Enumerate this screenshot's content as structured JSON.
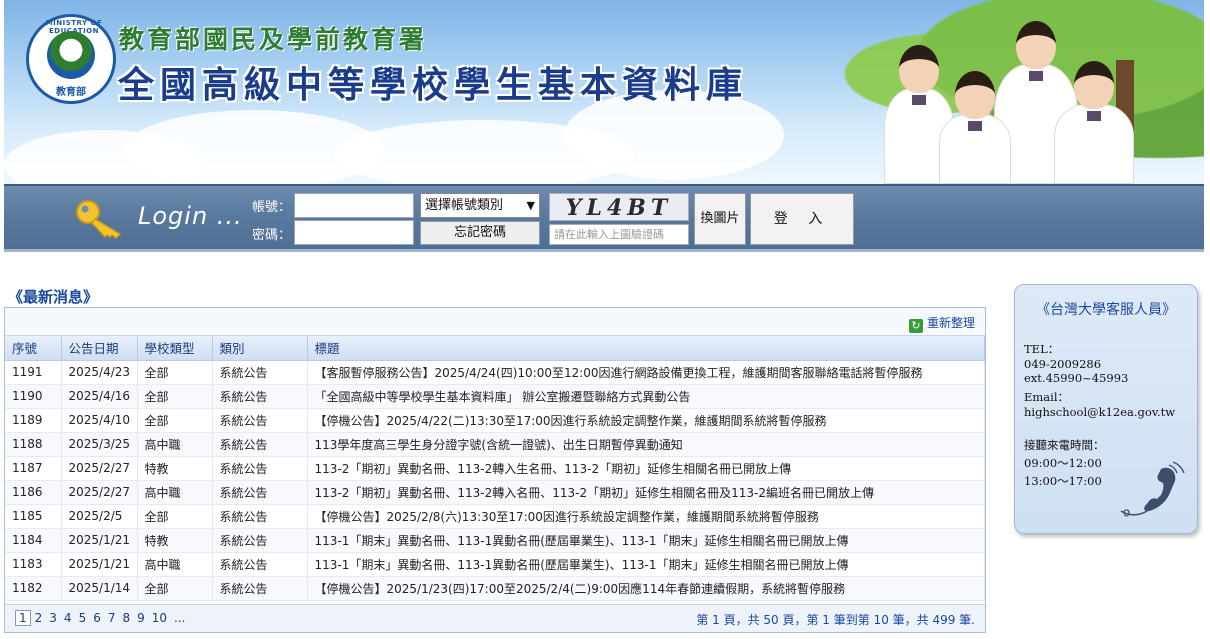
{
  "banner": {
    "logo_ring_text": "MINISTRY OF EDUCATION",
    "logo_bottom_text": "教育部",
    "sub_title": "教育部國民及學前教育署",
    "main_title": "全國高級中等學校學生基本資料庫"
  },
  "login": {
    "heading": "Login ...",
    "account_label": "帳號：",
    "password_label": "密碼：",
    "account_value": "",
    "password_value": "",
    "account_type_selected": "選擇帳號類別",
    "forgot_label": "忘記密碼",
    "captcha_text": "YL4BT",
    "captcha_placeholder": "請在此輸入上圖驗證碼",
    "swap_label": "換圖片",
    "login_label": "登 入"
  },
  "news": {
    "heading": "《最新消息》",
    "refresh_label": "重新整理",
    "columns": [
      "序號",
      "公告日期",
      "學校類型",
      "類別",
      "標題"
    ],
    "rows": [
      [
        "1191",
        "2025/4/23",
        "全部",
        "系統公告",
        "【客服暫停服務公告】2025/4/24(四)10:00至12:00因進行網路設備更換工程，維護期間客服聯絡電話將暫停服務"
      ],
      [
        "1190",
        "2025/4/16",
        "全部",
        "系統公告",
        "「全國高級中等學校學生基本資料庫」 辦公室搬遷暨聯絡方式異動公告"
      ],
      [
        "1189",
        "2025/4/10",
        "全部",
        "系統公告",
        "【停機公告】2025/4/22(二)13:30至17:00因進行系統設定調整作業，維護期間系統將暫停服務"
      ],
      [
        "1188",
        "2025/3/25",
        "高中職",
        "系統公告",
        "113學年度高三學生身分證字號(含統一證號)、出生日期暫停異動通知"
      ],
      [
        "1187",
        "2025/2/27",
        "特教",
        "系統公告",
        "113-2「期初」異動名冊、113-2轉入生名冊、113-2「期初」延修生相關名冊已開放上傳"
      ],
      [
        "1186",
        "2025/2/27",
        "高中職",
        "系統公告",
        "113-2「期初」異動名冊、113-2轉入名冊、113-2「期初」延修生相關名冊及113-2編班名冊已開放上傳"
      ],
      [
        "1185",
        "2025/2/5",
        "全部",
        "系統公告",
        "【停機公告】2025/2/8(六)13:30至17:00因進行系統設定調整作業，維護期間系統將暫停服務"
      ],
      [
        "1184",
        "2025/1/21",
        "特教",
        "系統公告",
        "113-1「期末」異動名冊、113-1異動名冊(歷屆畢業生)、113-1「期末」延修生相關名冊已開放上傳"
      ],
      [
        "1183",
        "2025/1/21",
        "高中職",
        "系統公告",
        "113-1「期末」異動名冊、113-1異動名冊(歷屆畢業生)、113-1「期末」延修生相關名冊已開放上傳"
      ],
      [
        "1182",
        "2025/1/14",
        "全部",
        "系統公告",
        "【停機公告】2025/1/23(四)17:00至2025/2/4(二)9:00因應114年春節連續假期，系統將暫停服務"
      ]
    ],
    "pages": [
      "1",
      "2",
      "3",
      "4",
      "5",
      "6",
      "7",
      "8",
      "9",
      "10",
      "..."
    ],
    "page_info": "第 1 頁，共 50 頁，第 1 筆到第 10 筆，共 499 筆."
  },
  "support": {
    "title": "《台灣大學客服人員》",
    "tel_label": "TEL：",
    "tel_value": "049-2009286 ext.45990~45993",
    "email_label": "Email：",
    "email_value": "highschool@k12ea.gov.tw",
    "hours_label": "接聽來電時間：",
    "hours_am": "09:00～12:00",
    "hours_pm": "13:00～17:00"
  }
}
